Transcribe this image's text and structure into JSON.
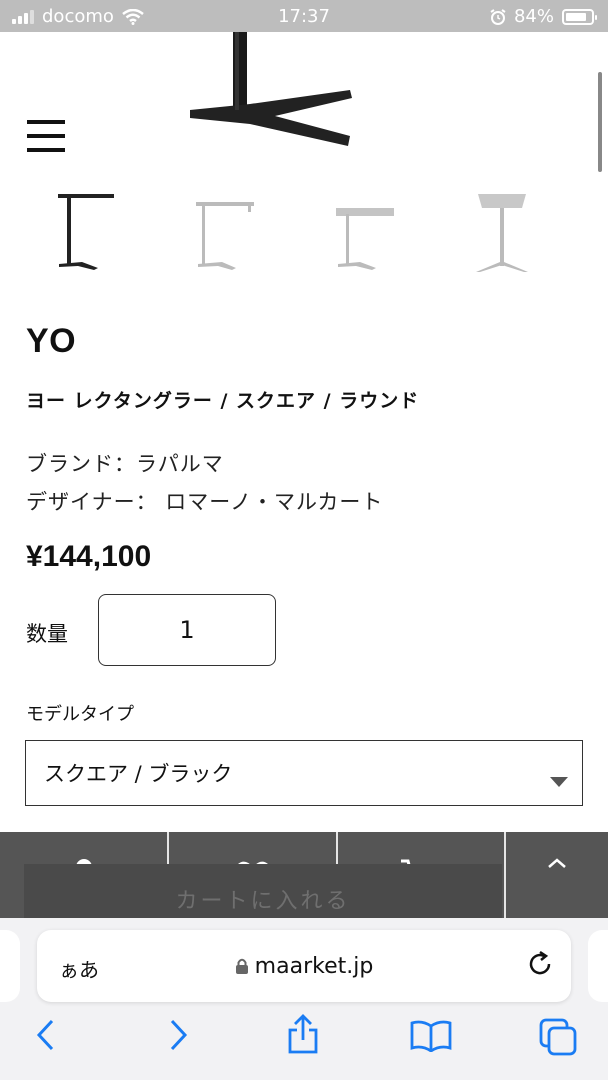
{
  "status_bar": {
    "carrier": "docomo",
    "time": "17:37",
    "battery": "84%"
  },
  "product": {
    "name": "YO",
    "subtitle": "ヨー レクタングラー / スクエア / ラウンド",
    "brand": "ブランド：ラパルマ",
    "designer": "デザイナー： ロマーノ・マルカート",
    "price": "¥144,100",
    "quantity_label": "数量",
    "quantity_value": "1",
    "model_label": "モデルタイプ",
    "model_selected": "スクエア / ブラック"
  },
  "bottom_bar": {
    "add_to_cart_label": "カートに入れる",
    "icons": [
      "person-icon",
      "heart-icon",
      "cart-icon",
      "chevron-up-icon"
    ]
  },
  "browser": {
    "aa_label": "ぁあ",
    "url": "maarket.jp"
  },
  "colors": {
    "status_bar_bg": "#bdbdbd",
    "bottom_bar_bg": "#555555",
    "accent_blue": "#1a7cf3"
  }
}
